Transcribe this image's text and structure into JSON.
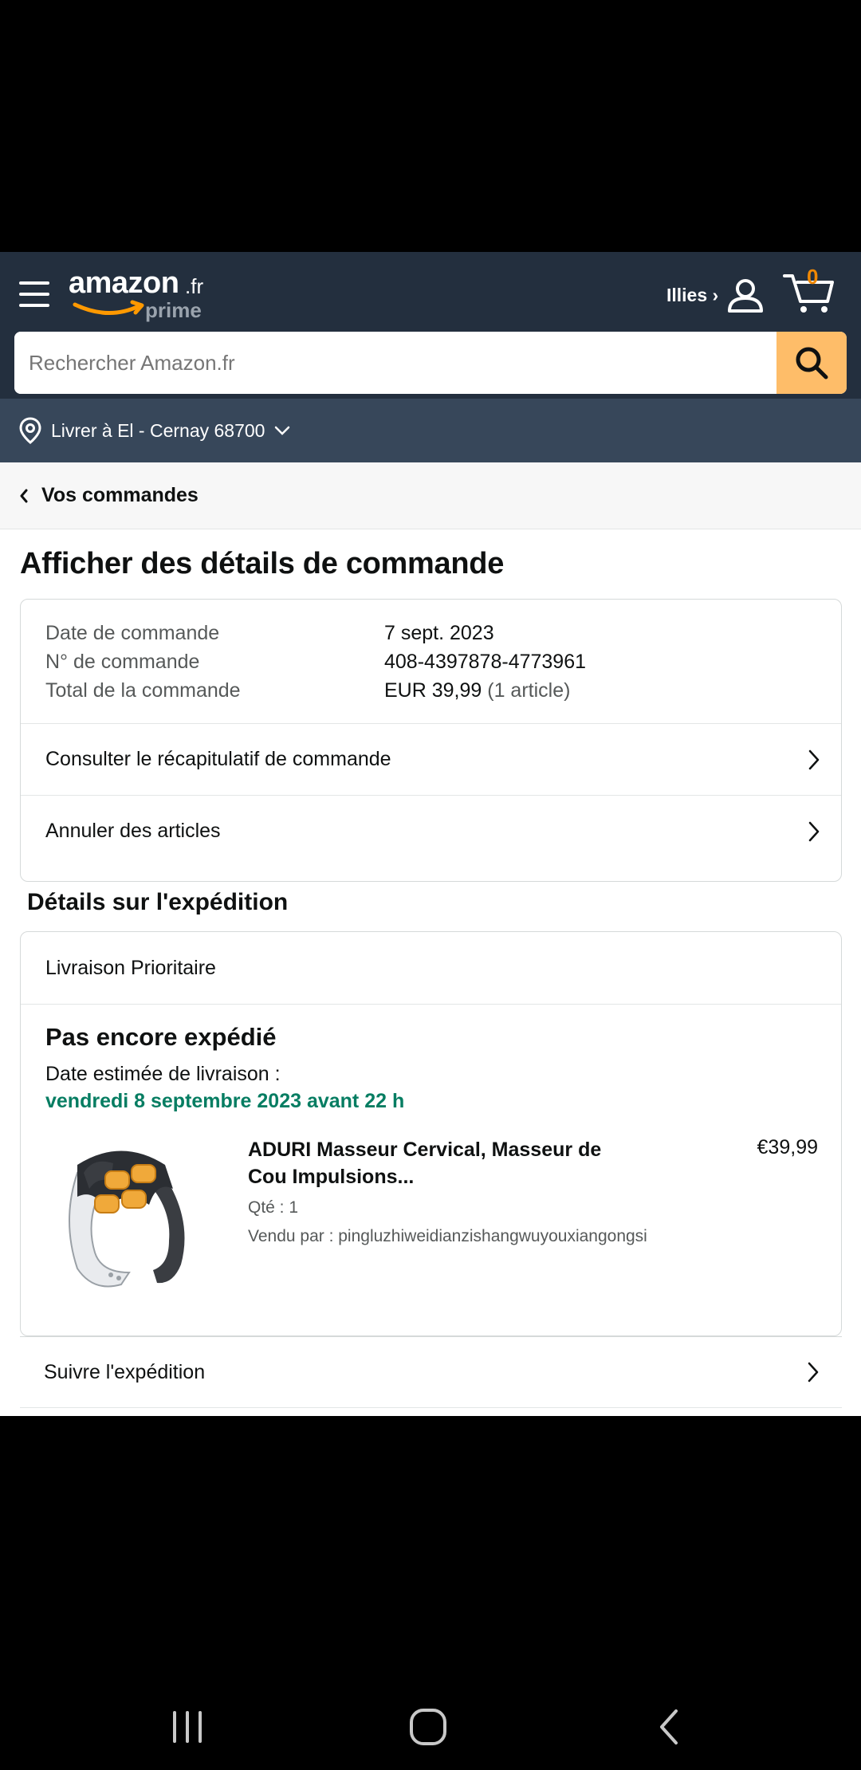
{
  "header": {
    "logo_word": "amazon",
    "logo_suffix": ".fr",
    "logo_prime": "prime",
    "account_name": "Illies ›",
    "cart_count": "0",
    "colors": {
      "header_bg": "#232f3e",
      "deliver_bg": "#37475a",
      "search_button": "#febd69",
      "cart_count": "#f08804"
    }
  },
  "search": {
    "placeholder": "Rechercher Amazon.fr",
    "value": ""
  },
  "deliver_to": {
    "label": "Livrer à El - Cernay 68700"
  },
  "breadcrumb": {
    "back_label": "Vos commandes"
  },
  "page_title": "Afficher des détails de commande",
  "order_info": {
    "rows": [
      {
        "label": "Date de commande",
        "value": "7 sept. 2023",
        "sub": ""
      },
      {
        "label": "N° de commande",
        "value": "408-4397878-4773961",
        "sub": ""
      },
      {
        "label": "Total de la commande",
        "value": "EUR 39,99",
        "sub": "(1 article)"
      }
    ],
    "links": [
      {
        "label": "Consulter le récapitulatif de commande"
      },
      {
        "label": "Annuler des articles"
      }
    ]
  },
  "shipping": {
    "section_title": "Détails sur l'expédition",
    "method": "Livraison Prioritaire",
    "status": "Pas encore expédié",
    "estimate_label": "Date estimée de livraison :",
    "estimate_date": "vendredi 8 septembre 2023 avant 22 h",
    "estimate_color": "#067d62",
    "product": {
      "name": "ADURI Masseur Cervical, Masseur de Cou Impulsions...",
      "qty": "Qté : 1",
      "seller": "Vendu par : pingluzhiweidianzishangwuyouxiangongsi",
      "price": "€39,99"
    },
    "track_label": "Suivre l'expédition"
  },
  "system_nav": {
    "icons": [
      "recent-apps-icon",
      "home-icon",
      "back-icon"
    ]
  }
}
